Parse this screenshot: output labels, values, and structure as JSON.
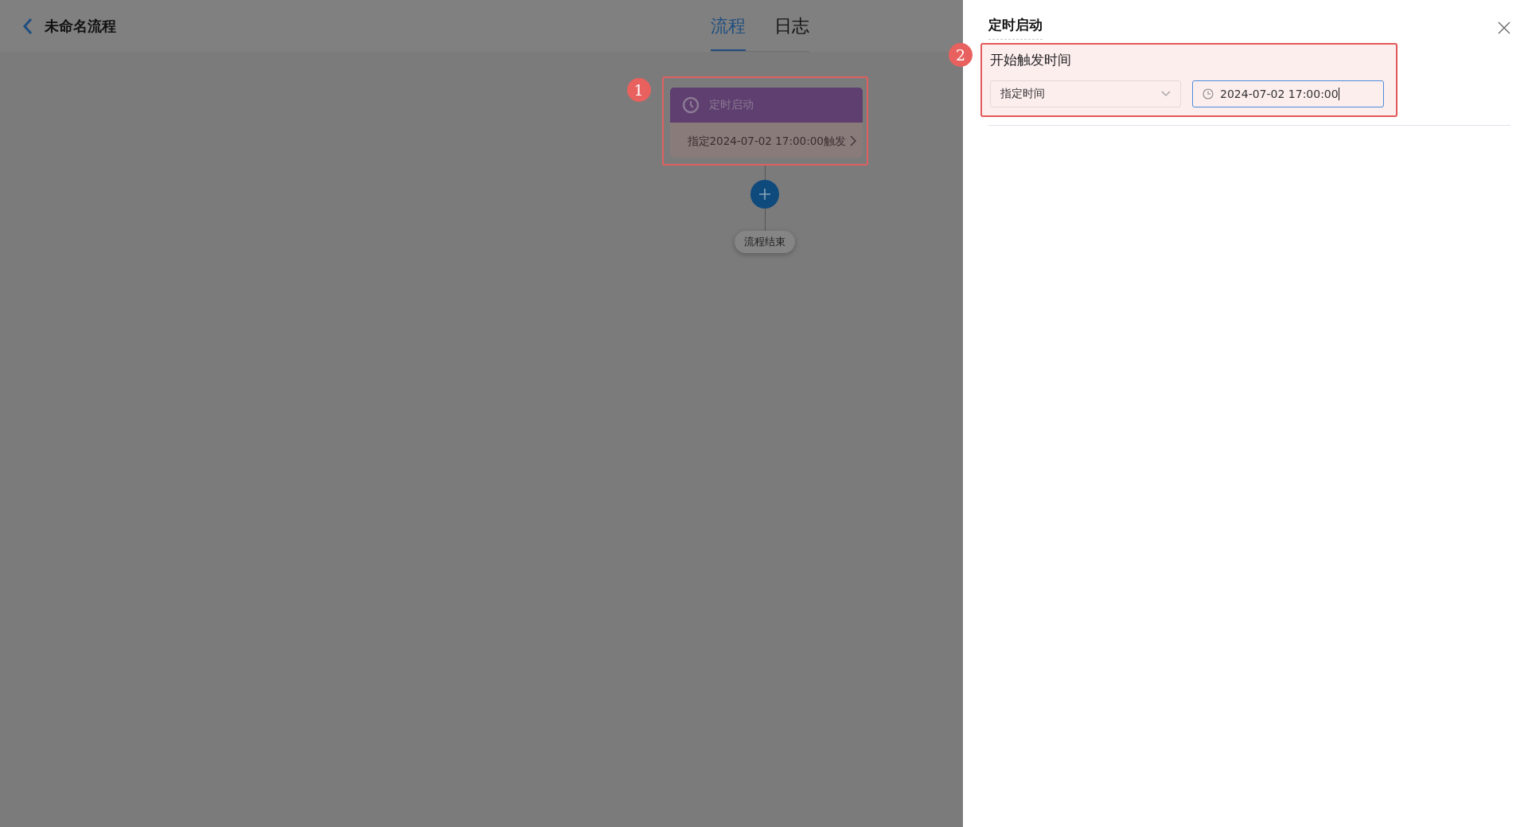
{
  "header": {
    "title": "未命名流程",
    "tabs": [
      {
        "label": "流程",
        "selected": true
      },
      {
        "label": "日志",
        "selected": false
      }
    ]
  },
  "flow": {
    "badge": "1",
    "start_node": {
      "title": "定时启动",
      "description": "指定2024-07-02 17:00:00触发"
    },
    "end_node": "流程结束"
  },
  "panel": {
    "title": "定时启动",
    "badge": "2",
    "field_label": "开始触发时间",
    "trigger_type": "指定时间",
    "time_value": "2024-07-02 17:00:00",
    "time_focused": true
  }
}
